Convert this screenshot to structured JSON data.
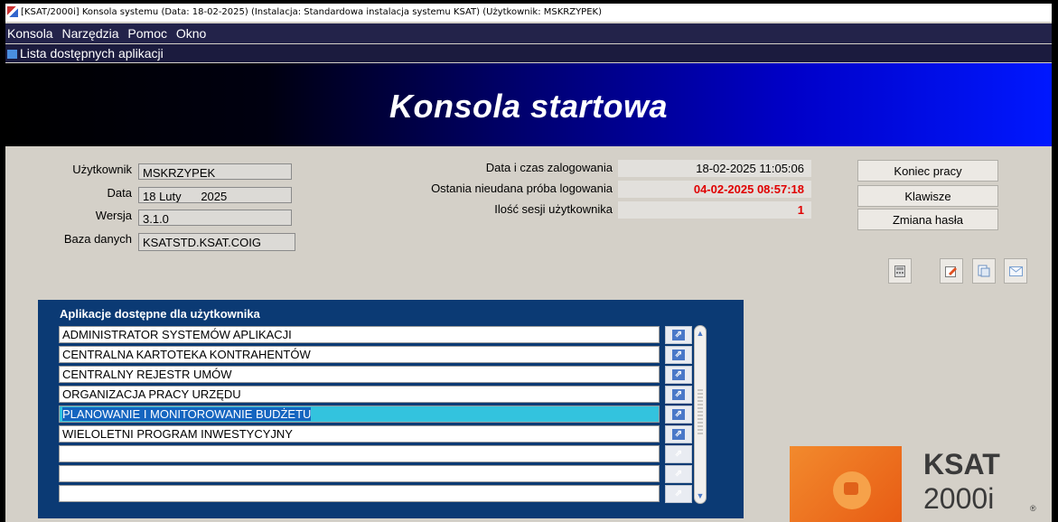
{
  "window": {
    "title": "[KSAT/2000i] Konsola systemu (Data: 18-02-2025) (Instalacja: Standardowa instalacja systemu KSAT) (Użytkownik: MSKRZYPEK)"
  },
  "menu": [
    "Konsola",
    "Narzędzia",
    "Pomoc",
    "Okno"
  ],
  "subwindow": {
    "title": "Lista dostępnych aplikacji"
  },
  "banner": {
    "title": "Konsola startowa"
  },
  "user_info": {
    "user_label": "Użytkownik",
    "user_value": "MSKRZYPEK",
    "date_label": "Data",
    "date_value": "18 Luty      2025",
    "version_label": "Wersja",
    "version_value": "3.1.0",
    "db_label": "Baza danych",
    "db_value": "KSATSTD.KSAT.COIG"
  },
  "session": {
    "login_label": "Data i czas zalogowania",
    "login_value": "18-02-2025 11:05:06",
    "failed_label": "Ostania nieudana próba logowania",
    "failed_value": "04-02-2025 08:57:18",
    "count_label": "Ilość sesji użytkownika",
    "count_value": "1"
  },
  "buttons": {
    "end": "Koniec pracy",
    "keys": "Klawisze",
    "password": "Zmiana hasła"
  },
  "icons": [
    "calculator-icon",
    "edit-icon",
    "document-icon",
    "mail-icon"
  ],
  "apps": {
    "header": "Aplikacje dostępne dla użytkownika",
    "rows": [
      "ADMINISTRATOR SYSTEMÓW APLIKACJI",
      "CENTRALNA KARTOTEKA KONTRAHENTÓW",
      "CENTRALNY REJESTR UMÓW",
      "ORGANIZACJA PRACY URZĘDU",
      "PLANOWANIE I MONITOROWANIE BUDŻETU",
      "WIELOLETNI PROGRAM INWESTYCYJNY",
      "",
      "",
      ""
    ],
    "selected_index": 4
  },
  "logo": {
    "name": "KSAT",
    "version": "2000i",
    "mark": "®"
  }
}
